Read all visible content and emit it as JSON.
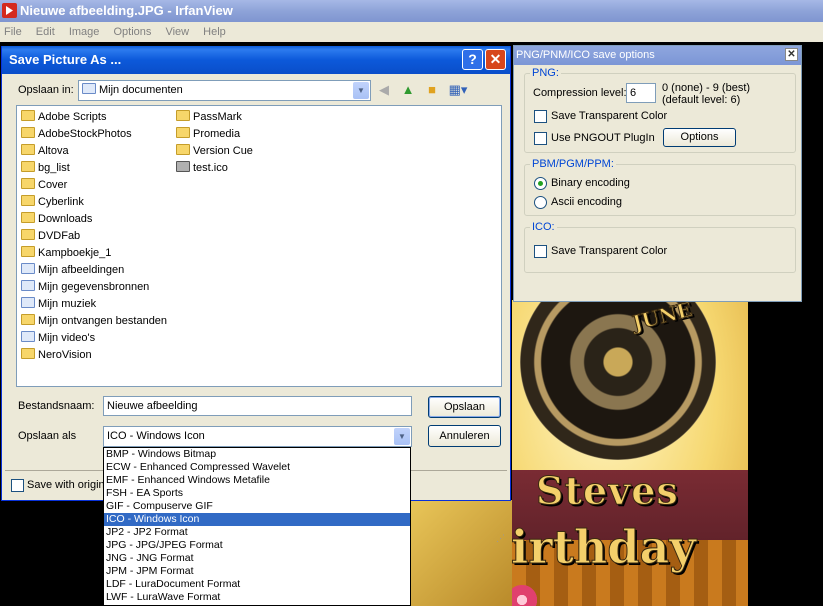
{
  "app": {
    "title": "Nieuwe afbeelding.JPG - IrfanView",
    "menu": [
      "File",
      "Edit",
      "Image",
      "Options",
      "View",
      "Help"
    ]
  },
  "photo": {
    "top_text": "JUNE",
    "name_text": "Steves",
    "day_text": "Birthday"
  },
  "dialog": {
    "title": "Save Picture As ...",
    "help_label": "?",
    "close_label": "✕",
    "look_in_label": "Opslaan in:",
    "look_in_value": "Mijn documenten",
    "files_col1": [
      "Adobe Scripts",
      "AdobeStockPhotos",
      "Altova",
      "bg_list",
      "Cover",
      "Cyberlink",
      "Downloads",
      "DVDFab",
      "Kampboekje_1",
      "Mijn afbeeldingen",
      "Mijn gegevensbronnen",
      "Mijn muziek",
      "Mijn ontvangen bestanden",
      "Mijn video's",
      "NeroVision"
    ],
    "files_col2": [
      "PassMark",
      "Promedia",
      "Version Cue",
      "test.ico"
    ],
    "filename_label": "Bestandsnaam:",
    "filename_value": "Nieuwe afbeelding",
    "savetype_label": "Opslaan als",
    "savetype_value": "ICO - Windows Icon",
    "save_button": "Opslaan",
    "cancel_button": "Annuleren",
    "save_with_original": "Save with origin",
    "filetype_options": [
      "BMP - Windows Bitmap",
      "ECW - Enhanced Compressed Wavelet",
      "EMF - Enhanced Windows Metafile",
      "FSH - EA Sports",
      "GIF - Compuserve GIF",
      "ICO - Windows Icon",
      "JP2 - JP2 Format",
      "JPG - JPG/JPEG Format",
      "JNG - JNG Format",
      "JPM - JPM Format",
      "LDF - LuraDocument Format",
      "LWF - LuraWave Format"
    ],
    "selected_option_index": 5
  },
  "options_panel": {
    "title": "PNG/PNM/ICO save options",
    "close_label": "✕",
    "png_group": "PNG:",
    "compression_label": "Compression level:",
    "compression_value": "6",
    "compression_hint_1": "0 (none) - 9 (best)",
    "compression_hint_2": "(default level: 6)",
    "save_transparent_png": "Save Transparent Color",
    "use_pngout": "Use PNGOUT PlugIn",
    "options_button": "Options",
    "pbm_group": "PBM/PGM/PPM:",
    "binary_encoding": "Binary encoding",
    "ascii_encoding": "Ascii encoding",
    "ico_group": "ICO:",
    "save_transparent_ico": "Save Transparent Color"
  }
}
